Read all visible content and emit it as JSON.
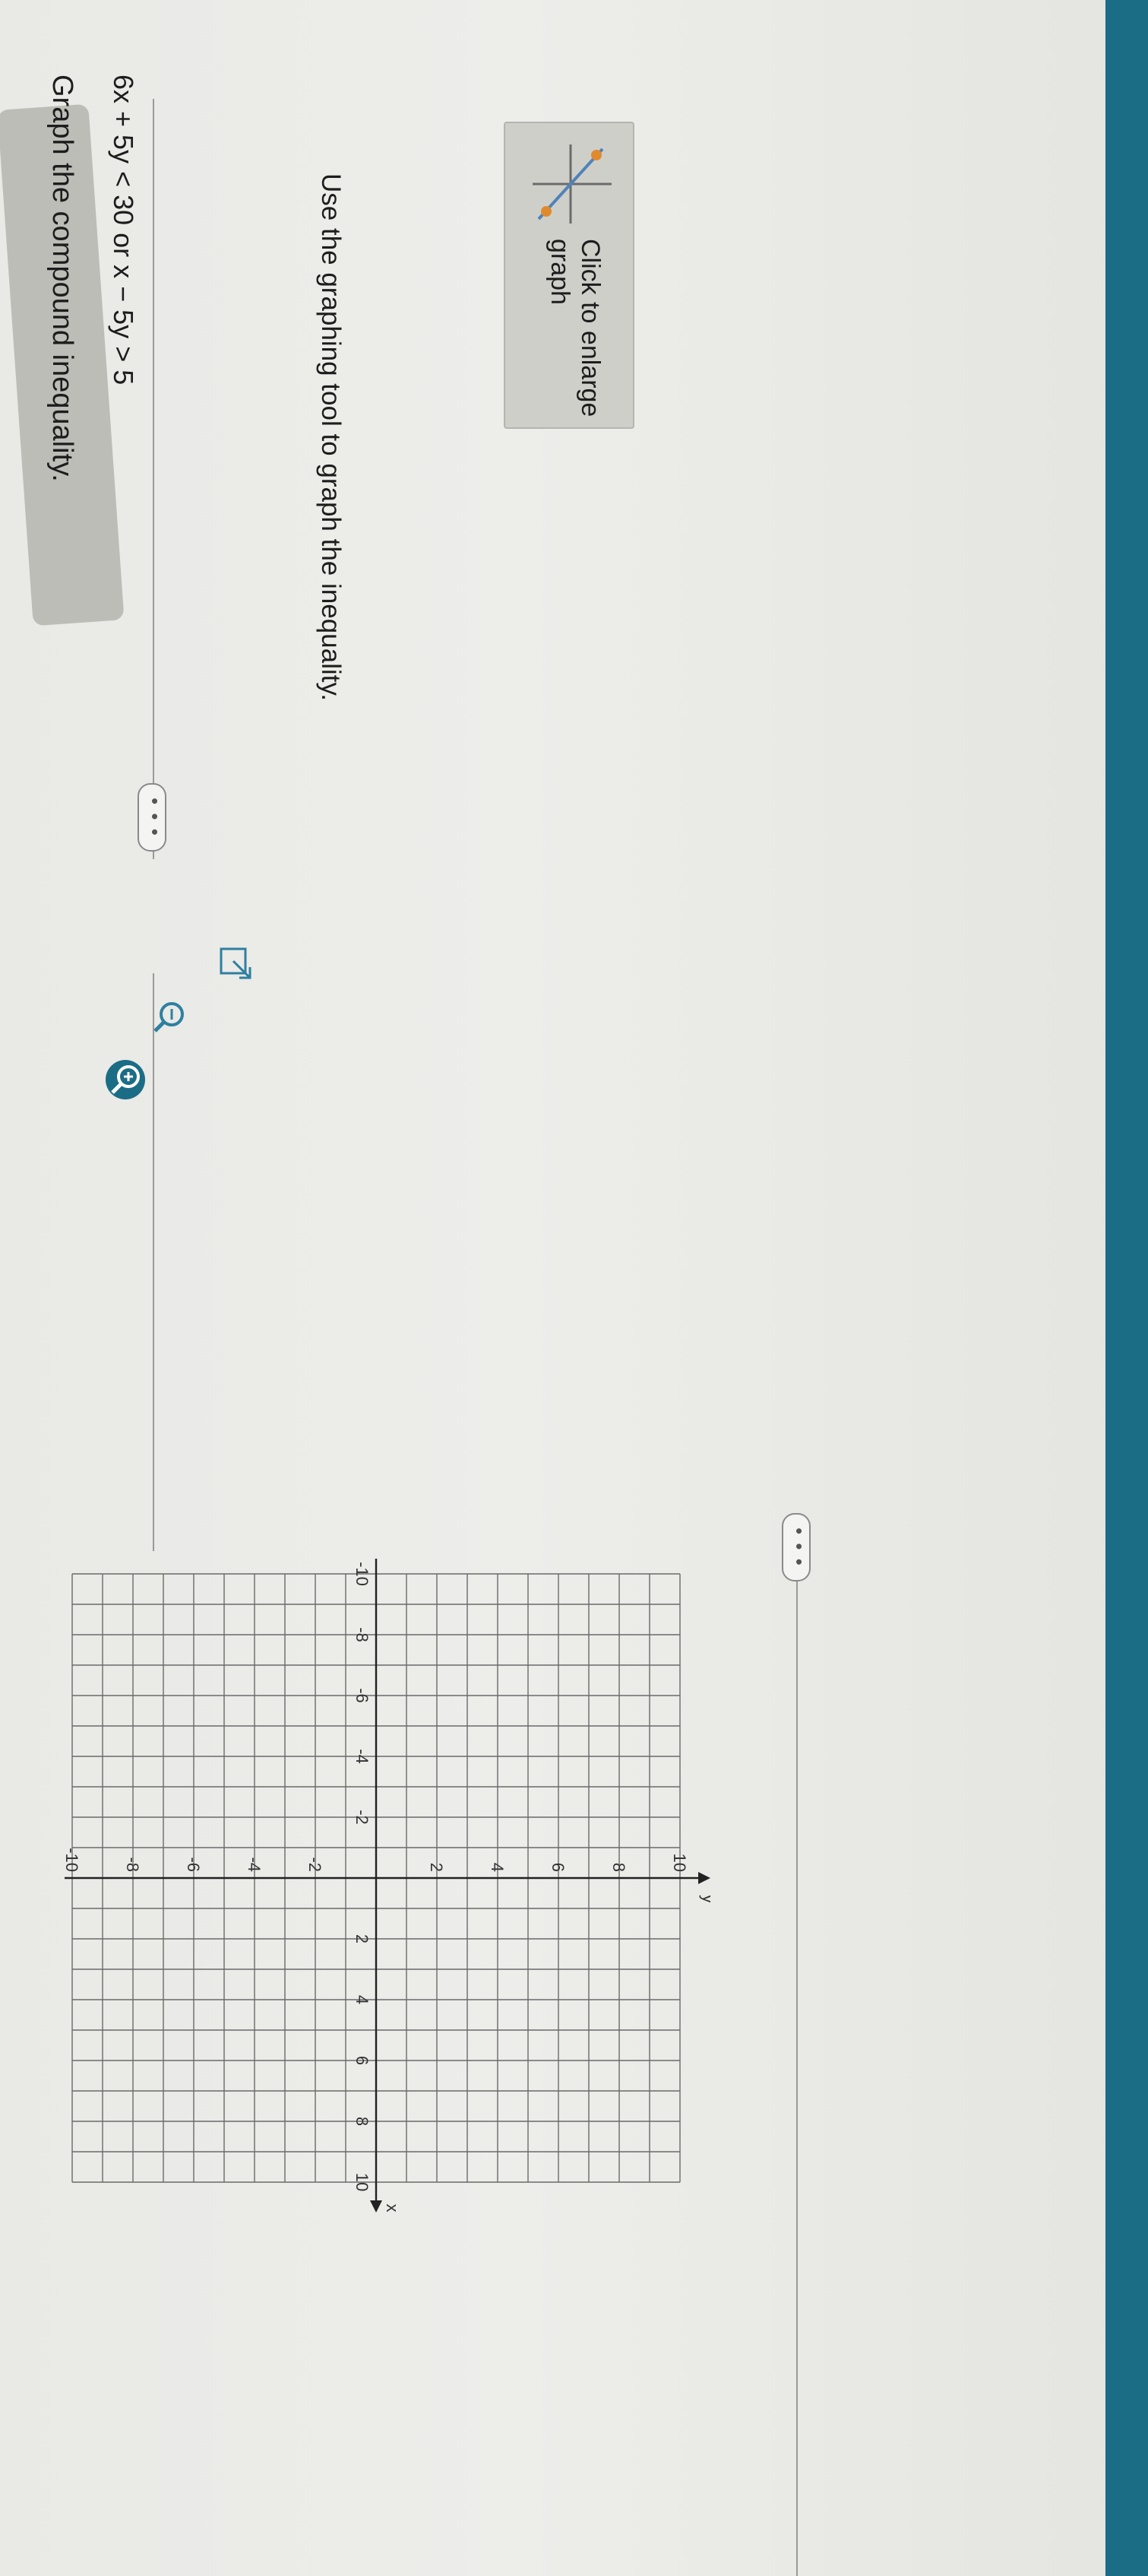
{
  "question": {
    "title": "Graph the compound inequality.",
    "inequality": "6x + 5y < 30 or x − 5y > 5",
    "instruction": "Use the graphing tool to graph the inequality."
  },
  "ui": {
    "enlarge_label": "Click to enlarge graph",
    "more_label": "• • •"
  },
  "graph": {
    "x_axis_label": "x",
    "y_axis_label": "y",
    "x_range": [
      -10,
      10
    ],
    "y_range": [
      -10,
      10
    ],
    "x_tick_labels": [
      "-10",
      "-8",
      "-6",
      "-4",
      "-2",
      "2",
      "4",
      "6",
      "8",
      "10"
    ],
    "y_tick_labels": [
      "10",
      "8",
      "6",
      "4",
      "2",
      "-2",
      "-4",
      "-6",
      "-8",
      "-10"
    ],
    "colors": {
      "grid": "#6a6a6a",
      "axis": "#222222",
      "accent": "#1b6d86"
    }
  }
}
